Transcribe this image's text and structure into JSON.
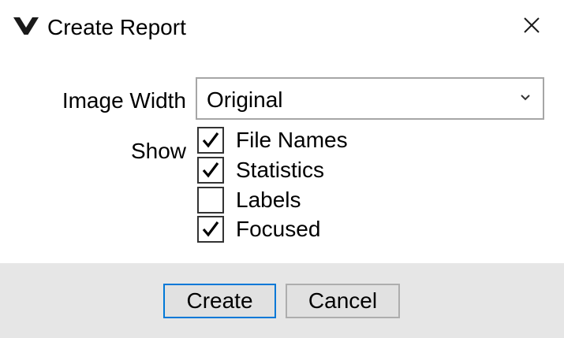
{
  "window": {
    "title": "Create Report",
    "logo_icon": "app-v-logo",
    "close_icon": "close-x"
  },
  "form": {
    "image_width": {
      "label": "Image Width",
      "selected": "Original"
    },
    "show": {
      "label": "Show",
      "options": [
        {
          "label": "File Names",
          "checked": true
        },
        {
          "label": "Statistics",
          "checked": true
        },
        {
          "label": "Labels",
          "checked": false
        },
        {
          "label": "Focused",
          "checked": true
        }
      ]
    }
  },
  "buttons": {
    "create": "Create",
    "cancel": "Cancel"
  },
  "colors": {
    "footer_bg": "#e6e6e6",
    "focus_border": "#0078d7",
    "select_border": "#a6a6a6"
  }
}
